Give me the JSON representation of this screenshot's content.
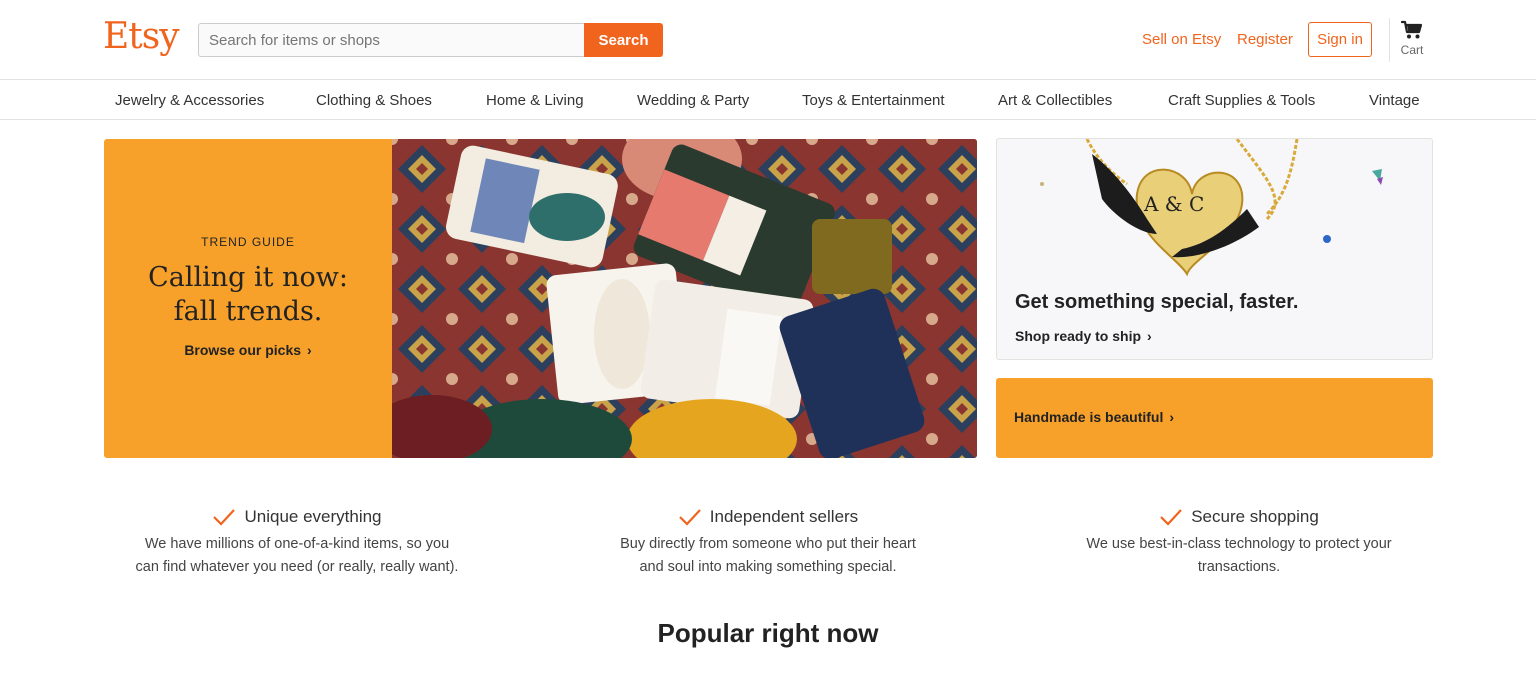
{
  "header": {
    "logo": "Etsy",
    "search_placeholder": "Search for items or shops",
    "search_button": "Search",
    "sell_link": "Sell on Etsy",
    "register_link": "Register",
    "signin_button": "Sign in",
    "cart_label": "Cart",
    "accent_color": "#f1641e"
  },
  "categories": [
    "Jewelry & Accessories",
    "Clothing & Shoes",
    "Home & Living",
    "Wedding & Party",
    "Toys & Entertainment",
    "Art & Collectibles",
    "Craft Supplies & Tools",
    "Vintage"
  ],
  "hero": {
    "eyebrow": "TREND GUIDE",
    "title": "Calling it now: fall trends.",
    "cta": "Browse our picks",
    "panel_color": "#f7a12b"
  },
  "side_promos": {
    "top_title": "Get something special, faster.",
    "top_cta": "Shop ready to ship",
    "necklace_text": "A & C",
    "bottom_cta": "Handmade is beautiful"
  },
  "values": [
    {
      "title": "Unique everything",
      "desc_line1": "We have millions of one-of-a-kind items, so you",
      "desc_line2": "can find whatever you need (or really, really want)."
    },
    {
      "title": "Independent sellers",
      "desc_line1": "Buy directly from someone who put their heart",
      "desc_line2": "and soul into making something special."
    },
    {
      "title": "Secure shopping",
      "desc_line1": "We use best-in-class technology to protect your",
      "desc_line2": "transactions."
    }
  ],
  "popular_heading": "Popular right now"
}
